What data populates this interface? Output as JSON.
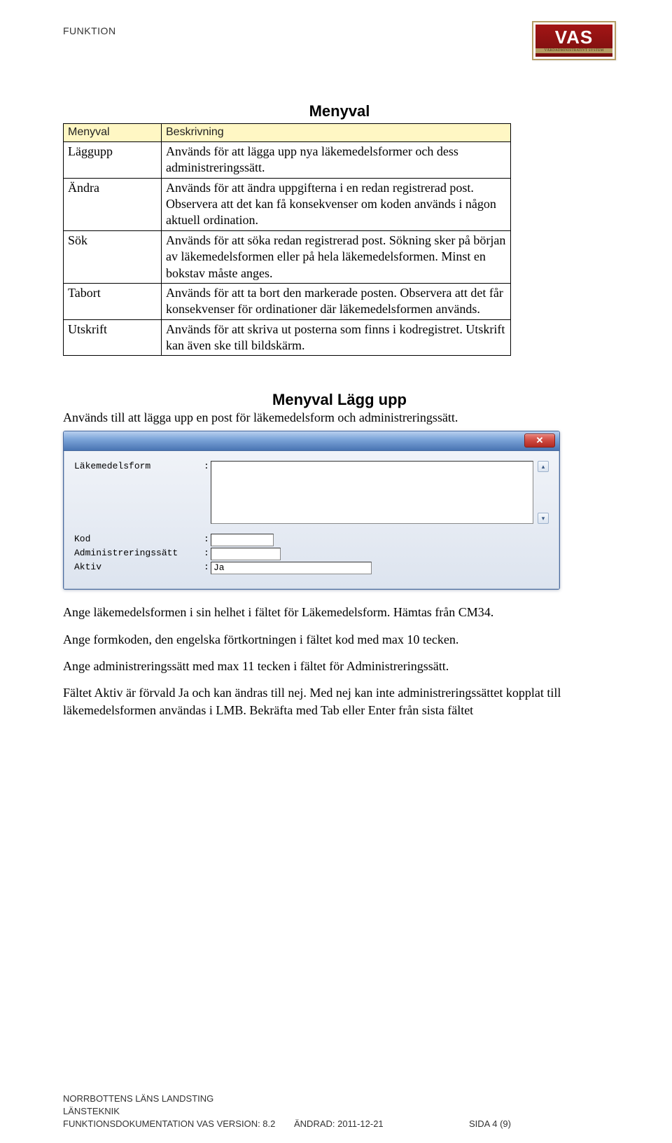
{
  "header": {
    "left": "FUNKTION",
    "logo_text": "VAS",
    "logo_sub": "VÅRDADMINISTRATIVT SYSTEM"
  },
  "menyval_table": {
    "title": "Menyval",
    "col1_header": "Menyval",
    "col2_header": "Beskrivning",
    "rows": [
      {
        "name": "Läggupp",
        "desc": "Används för att lägga upp nya läkemedelsformer och dess administreringssätt."
      },
      {
        "name": "Ändra",
        "desc": "Används för att ändra uppgifterna i en redan registrerad post. Observera att det kan få konsekvenser om koden används i någon aktuell ordination."
      },
      {
        "name": "Sök",
        "desc": "Används för att söka redan registrerad post. Sökning sker på början av läkemedelsformen eller på hela läkemedelsformen. Minst en bokstav måste anges."
      },
      {
        "name": "Tabort",
        "desc": "Används för att ta bort den markerade posten. Observera att det får konsekvenser för ordinationer där läkemedelsformen används."
      },
      {
        "name": "Utskrift",
        "desc": "Används för att skriva ut posterna som finns i kodregistret. Utskrift kan även ske till bildskärm."
      }
    ]
  },
  "lagg_upp": {
    "title": "Menyval Lägg upp",
    "desc": "Används till att lägga upp en post för läkemedelsform och administreringssätt.",
    "fields": {
      "lakemedelsform_label": "Läkemedelsform",
      "lakemedelsform_value": "",
      "kod_label": "Kod",
      "kod_value": "",
      "admin_label": "Administreringssätt",
      "admin_value": "",
      "aktiv_label": "Aktiv",
      "aktiv_value": "Ja"
    },
    "close_symbol": "✕",
    "scroll_up": "▴",
    "scroll_down": "▾"
  },
  "paragraphs": {
    "p1": "Ange läkemedelsformen i sin helhet i fältet för Läkemedelsform. Hämtas från CM34.",
    "p2": "Ange formkoden, den engelska förtkortningen i fältet kod med max 10 tecken.",
    "p3": "Ange administreringssätt med max  11 tecken i fältet för Administreringssätt.",
    "p4": "Fältet Aktiv är förvald Ja och kan ändras till nej. Med nej kan inte administreringssättet kopplat till läkemedelsformen användas i LMB. Bekräfta med Tab eller Enter från sista fältet"
  },
  "footer": {
    "org": "NORRBOTTENS LÄNS LANDSTING",
    "dept": "LÄNSTEKNIK",
    "doc": "FUNKTIONSDOKUMENTATION VAS VERSION: 8.2",
    "changed": "ÄNDRAD: 2011-12-21",
    "page": "SIDA 4 (9)"
  }
}
